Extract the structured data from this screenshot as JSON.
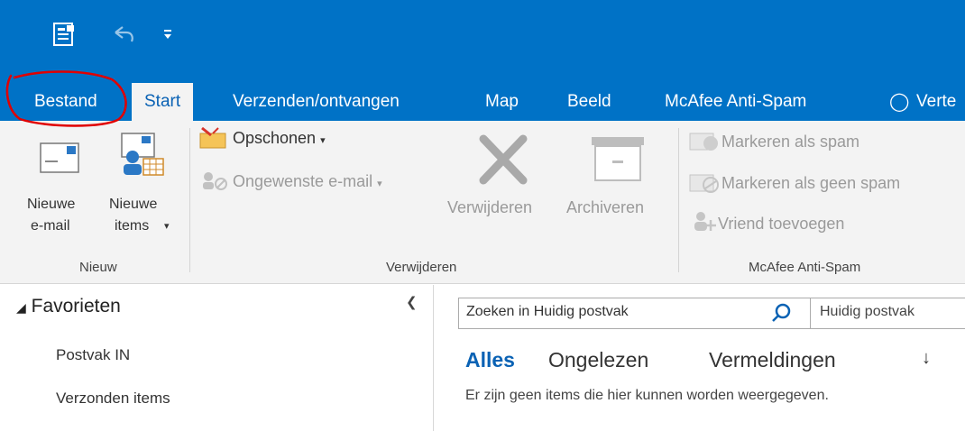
{
  "ribbon_tabs": [
    {
      "label": "Bestand"
    },
    {
      "label": "Start"
    },
    {
      "label": "Verzenden/ontvangen"
    },
    {
      "label": "Map"
    },
    {
      "label": "Beeld"
    },
    {
      "label": "McAfee Anti-Spam"
    },
    {
      "label": "Verte"
    }
  ],
  "groups": {
    "nieuw": {
      "name": "Nieuw",
      "new_email": {
        "line1": "Nieuwe",
        "line2": "e-mail"
      },
      "new_items": {
        "line1": "Nieuwe",
        "line2": "items"
      }
    },
    "verwijderen": {
      "name": "Verwijderen",
      "opschonen": "Opschonen",
      "ongewenste": "Ongewenste e-mail",
      "verwijderen": "Verwijderen",
      "archiveren": "Archiveren"
    },
    "mcafee": {
      "name": "McAfee Anti-Spam",
      "mark_spam": "Markeren als spam",
      "mark_not_spam": "Markeren als geen spam",
      "add_friend": "Vriend toevoegen"
    }
  },
  "folders": {
    "favorites_title": "Favorieten",
    "items": [
      "Postvak IN",
      "Verzonden items"
    ]
  },
  "search": {
    "placeholder": "Zoeken in Huidig postvak",
    "scope": "Huidig postvak"
  },
  "filters": [
    "Alles",
    "Ongelezen",
    "Vermeldingen"
  ],
  "empty_message": "Er zijn geen items die hier kunnen worden weergegeven.",
  "colors": {
    "brand": "#0072c6",
    "ribbon_bg": "#f3f3f3",
    "accent_text": "#0a62b4",
    "annotation": "#e00000"
  }
}
